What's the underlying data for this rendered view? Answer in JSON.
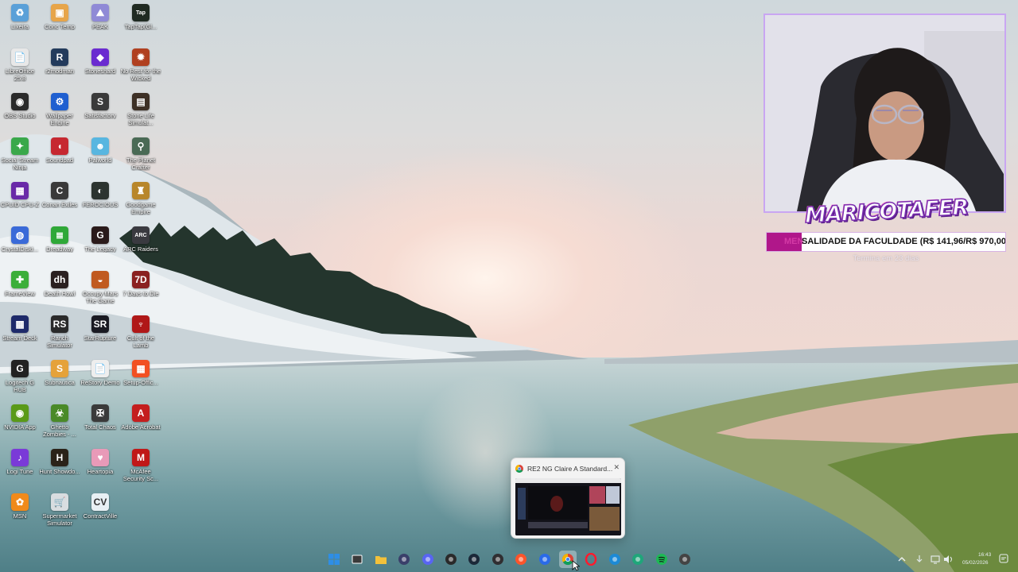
{
  "desktop": {
    "icons": [
      {
        "label": "Lixeira",
        "icon": "recycle-bin-icon",
        "color": "#5aa0d8",
        "glyph": "♻"
      },
      {
        "label": "Conc Temp",
        "icon": "folder-app-icon",
        "color": "#e7a54a",
        "glyph": "▣"
      },
      {
        "label": "PEAK",
        "icon": "peak-game-icon",
        "color": "#8f8ad6",
        "glyph": "⛰"
      },
      {
        "label": "TapTap(Gl...",
        "icon": "taptap-icon",
        "color": "#1f2a22",
        "glyph": "Tap"
      },
      {
        "label": "LibreOffice 25.8",
        "icon": "libreoffice-icon",
        "color": "#e8e8e8",
        "glyph": "📄"
      },
      {
        "label": "r2modman",
        "icon": "r2modman-icon",
        "color": "#233b5c",
        "glyph": "R"
      },
      {
        "label": "Stoneshard",
        "icon": "stoneshard-icon",
        "color": "#6a2bd0",
        "glyph": "◆"
      },
      {
        "label": "No Rest for the Wicked",
        "icon": "no-rest-icon",
        "color": "#b04020",
        "glyph": "✹"
      },
      {
        "label": "OBS Studio",
        "icon": "obs-icon",
        "color": "#2a2a2a",
        "glyph": "◉"
      },
      {
        "label": "Wallpaper Engine",
        "icon": "wallpaper-engine-icon",
        "color": "#1f5fd0",
        "glyph": "⚙"
      },
      {
        "label": "Satisfactory",
        "icon": "satisfactory-icon",
        "color": "#3a3a3a",
        "glyph": "S"
      },
      {
        "label": "Stone Life Simulat...",
        "icon": "stone-life-icon",
        "color": "#3d3025",
        "glyph": "▤"
      },
      {
        "label": "Social Stream Ninja",
        "icon": "social-stream-icon",
        "color": "#3aa84a",
        "glyph": "✦"
      },
      {
        "label": "Soundpad",
        "icon": "soundpad-icon",
        "color": "#c62830",
        "glyph": "◖"
      },
      {
        "label": "Palworld",
        "icon": "palworld-icon",
        "color": "#58b6e0",
        "glyph": "☻"
      },
      {
        "label": "The Planet Crafter",
        "icon": "planet-crafter-icon",
        "color": "#4a6a55",
        "glyph": "⚲"
      },
      {
        "label": "CPUID CPU-Z",
        "icon": "cpuz-icon",
        "color": "#6a2aa8",
        "glyph": "▦"
      },
      {
        "label": "Conan Exiles",
        "icon": "conan-icon",
        "color": "#3a3a3a",
        "glyph": "C"
      },
      {
        "label": "FEROCIOUS",
        "icon": "ferocious-icon",
        "color": "#2c3430",
        "glyph": "◐"
      },
      {
        "label": "Goodgame Empire",
        "icon": "goodgame-icon",
        "color": "#b8862a",
        "glyph": "♜"
      },
      {
        "label": "CrystalDiskI...",
        "icon": "crystaldisk-icon",
        "color": "#3a6ad8",
        "glyph": "◍"
      },
      {
        "label": "Dreadway",
        "icon": "dreadway-icon",
        "color": "#2fa838",
        "glyph": "≣"
      },
      {
        "label": "The Legacy",
        "icon": "the-legacy-icon",
        "color": "#2a1a1a",
        "glyph": "G"
      },
      {
        "label": "ARC Raiders",
        "icon": "arc-raiders-icon",
        "color": "#3a3a40",
        "glyph": "ARC"
      },
      {
        "label": "FrameView",
        "icon": "frameview-icon",
        "color": "#3cae3a",
        "glyph": "✚"
      },
      {
        "label": "Death Howl",
        "icon": "death-howl-icon",
        "color": "#2a2020",
        "glyph": "dh"
      },
      {
        "label": "Occupy Mars The Game",
        "icon": "occupy-mars-icon",
        "color": "#c05a20",
        "glyph": "◒"
      },
      {
        "label": "7 Days to Die",
        "icon": "7-days-icon",
        "color": "#8a2020",
        "glyph": "7D"
      },
      {
        "label": "Stream Deck",
        "icon": "stream-deck-icon",
        "color": "#1e2a6a",
        "glyph": "▦"
      },
      {
        "label": "Ranch Simulator",
        "icon": "ranch-simulator-icon",
        "color": "#2a2a2a",
        "glyph": "RS"
      },
      {
        "label": "StarRupture",
        "icon": "star-rupture-icon",
        "color": "#1a1a22",
        "glyph": "SR"
      },
      {
        "label": "Cult of the Lamb",
        "icon": "cult-of-the-lamb-icon",
        "color": "#b01818",
        "glyph": "♆"
      },
      {
        "label": "Logitech G HUB",
        "icon": "logitech-icon",
        "color": "#222222",
        "glyph": "G"
      },
      {
        "label": "Subnautica",
        "icon": "subnautica-icon",
        "color": "#e5a23a",
        "glyph": "S"
      },
      {
        "label": "ReStory Demo",
        "icon": "restory-icon",
        "color": "#eeeeee",
        "glyph": "📄"
      },
      {
        "label": "Setup-Offic...",
        "icon": "office-setup-icon",
        "color": "#f25022",
        "glyph": "▦"
      },
      {
        "label": "NVIDIA App",
        "icon": "nvidia-icon",
        "color": "#5a9a18",
        "glyph": "◉"
      },
      {
        "label": "Ghetto Zombies - ...",
        "icon": "ghetto-zombies-icon",
        "color": "#4a8a28",
        "glyph": "☣"
      },
      {
        "label": "Total Chaos",
        "icon": "total-chaos-icon",
        "color": "#3a3a3a",
        "glyph": "✠"
      },
      {
        "label": "Adobe Acrobat",
        "icon": "adobe-acrobat-icon",
        "color": "#c41e1e",
        "glyph": "A"
      },
      {
        "label": "Logi Tune",
        "icon": "logi-tune-icon",
        "color": "#7a3ad8",
        "glyph": "♪"
      },
      {
        "label": "Hunt Showdo...",
        "icon": "hunt-showdown-icon",
        "color": "#2a2218",
        "glyph": "H"
      },
      {
        "label": "Heartopia",
        "icon": "heartopia-icon",
        "color": "#e89ab8",
        "glyph": "♥"
      },
      {
        "label": "McAfee Security Sc...",
        "icon": "mcafee-icon",
        "color": "#c01818",
        "glyph": "M"
      },
      {
        "label": "MSN",
        "icon": "msn-icon",
        "color": "#f08a1a",
        "glyph": "✿"
      },
      {
        "label": "Supermarket Simulator",
        "icon": "supermarket-simulator-icon",
        "color": "#d8dde0",
        "glyph": "🛒"
      },
      {
        "label": "ContractVille",
        "icon": "contractville-icon",
        "color": "#e8f0f4",
        "glyph": "CV"
      }
    ]
  },
  "overlay": {
    "brand": "MARICOTAFER",
    "goal": {
      "prefix": "MEN",
      "text": "SALIDADE DA FACULDADE (R$ 141,96/R$ 970,00)",
      "progress": 0.1463,
      "subtitle": "Termina em 23 dias"
    }
  },
  "preview": {
    "title": "RE2 NG Claire A Standard...",
    "app_icon": "chrome-icon",
    "close": "✕"
  },
  "taskbar": {
    "items": [
      {
        "name": "start-button",
        "icon": "windows-icon",
        "color": "#2e8ee6"
      },
      {
        "name": "task-view-button",
        "icon": "task-view-icon",
        "color": "#ffffff"
      },
      {
        "name": "file-explorer-button",
        "icon": "folder-icon",
        "color": "#f3c13a"
      },
      {
        "name": "app-button-1",
        "icon": "app-icon",
        "color": "#3a3f6a"
      },
      {
        "name": "discord-button",
        "icon": "discord-icon",
        "color": "#5865f2"
      },
      {
        "name": "epic-games-button",
        "icon": "epic-games-icon",
        "color": "#2a2a2a"
      },
      {
        "name": "steam-button",
        "icon": "steam-icon",
        "color": "#1b2838"
      },
      {
        "name": "obs-button",
        "icon": "obs-icon",
        "color": "#302e31"
      },
      {
        "name": "brave-button",
        "icon": "brave-icon",
        "color": "#fb542b"
      },
      {
        "name": "app-button-2",
        "icon": "app-icon",
        "color": "#2a6ae8"
      },
      {
        "name": "chrome-button",
        "icon": "chrome-icon",
        "color": "#4285f4",
        "active": true
      },
      {
        "name": "opera-button",
        "icon": "opera-icon",
        "color": "#ff1b2d"
      },
      {
        "name": "edge-button",
        "icon": "edge-icon",
        "color": "#1c8ad6"
      },
      {
        "name": "edge-dev-button",
        "icon": "edge-dev-icon",
        "color": "#1fa67a"
      },
      {
        "name": "spotify-button",
        "icon": "spotify-icon",
        "color": "#1db954"
      },
      {
        "name": "settings-button",
        "icon": "settings-icon",
        "color": "#444444"
      }
    ],
    "clock": {
      "time": "16:43",
      "date": "05/02/2026"
    }
  }
}
